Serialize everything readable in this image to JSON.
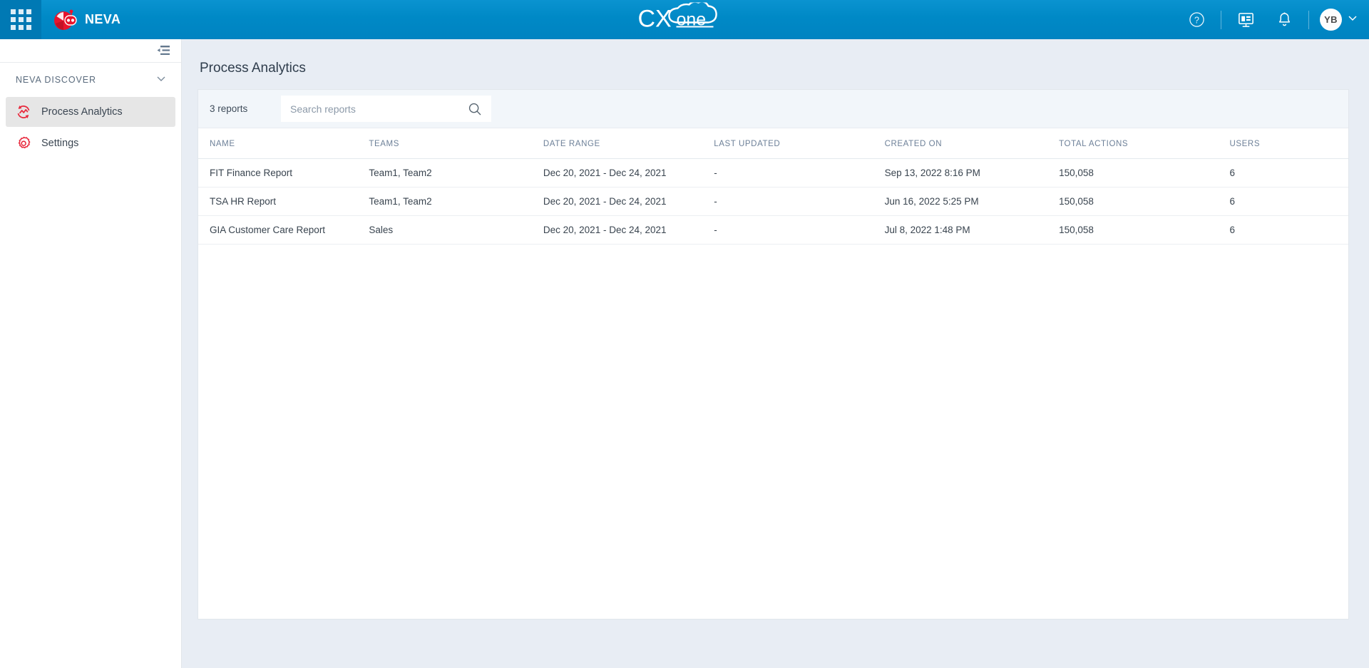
{
  "topbar": {
    "app_grid_icon": "apps-grid-icon",
    "brand_logo_icon": "neva-robot-logo-icon",
    "brand_name": "NEVA",
    "center_logo_text": "CXone",
    "center_logo_part1": "CX",
    "center_logo_part2": "one",
    "help_icon": "help-circle-icon",
    "dashboard_icon": "presentation-screen-icon",
    "notifications_icon": "bell-icon",
    "avatar_initials": "YB",
    "avatar_chevron_icon": "chevron-down-icon",
    "accent_blue": "#0089c6",
    "grid_bg": "#0079b4"
  },
  "sidebar": {
    "collapse_icon": "collapse-panel-icon",
    "section_label": "NEVA DISCOVER",
    "section_chevron_icon": "chevron-down-icon",
    "items": [
      {
        "label": "Process Analytics",
        "icon": "process-analytics-icon",
        "active": true
      },
      {
        "label": "Settings",
        "icon": "gear-icon",
        "active": false
      }
    ],
    "icon_color": "#e8283c",
    "active_bg": "#e6e6e6"
  },
  "main": {
    "page_title": "Process Analytics",
    "toolbar": {
      "report_count": "3 reports",
      "search_placeholder": "Search reports",
      "search_value": "",
      "search_icon": "search-icon"
    },
    "table": {
      "columns": [
        "NAME",
        "TEAMS",
        "DATE RANGE",
        "LAST UPDATED",
        "CREATED ON",
        "TOTAL ACTIONS",
        "USERS"
      ],
      "rows": [
        {
          "name": "FIT Finance Report",
          "teams": "Team1, Team2",
          "date_range": "Dec 20, 2021 - Dec 24, 2021",
          "last_updated": "-",
          "created_on": "Sep 13, 2022 8:16 PM",
          "total_actions": "150,058",
          "users": "6"
        },
        {
          "name": "TSA HR Report",
          "teams": "Team1, Team2",
          "date_range": "Dec 20, 2021 - Dec 24, 2021",
          "last_updated": "-",
          "created_on": "Jun 16, 2022 5:25 PM",
          "total_actions": "150,058",
          "users": "6"
        },
        {
          "name": "GIA Customer Care Report",
          "teams": "Sales",
          "date_range": "Dec 20, 2021 - Dec 24, 2021",
          "last_updated": "-",
          "created_on": "Jul 8, 2022 1:48 PM",
          "total_actions": "150,058",
          "users": "6"
        }
      ]
    }
  }
}
